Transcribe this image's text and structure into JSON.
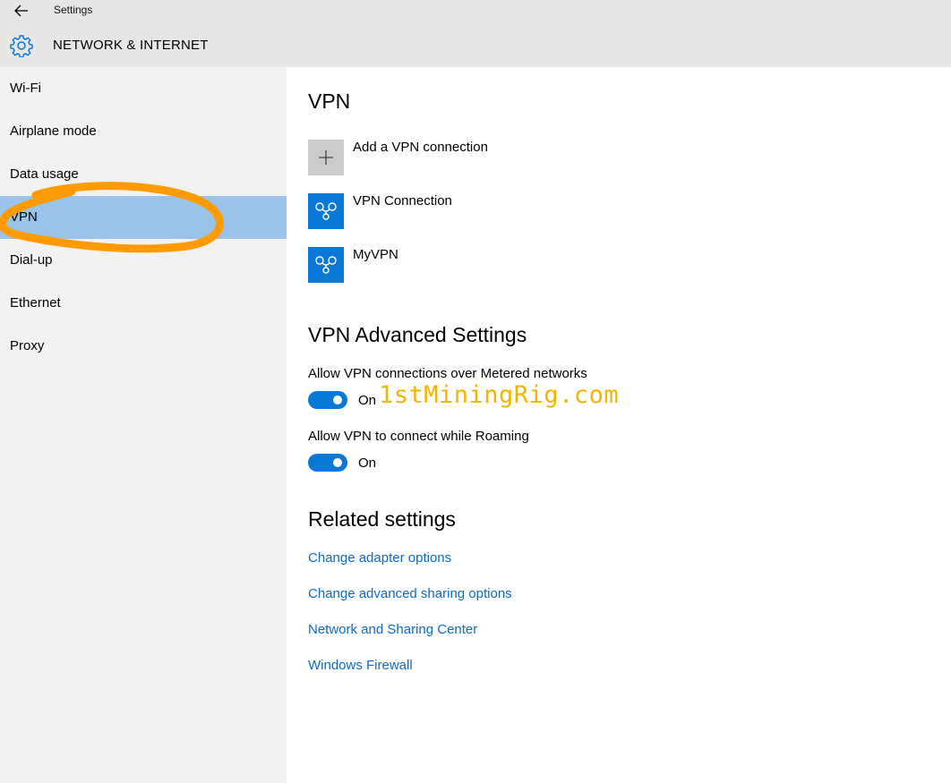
{
  "titlebar": {
    "app_title": "Settings"
  },
  "header": {
    "section_title": "NETWORK & INTERNET"
  },
  "sidebar": {
    "items": [
      {
        "label": "Wi-Fi",
        "selected": false
      },
      {
        "label": "Airplane mode",
        "selected": false
      },
      {
        "label": "Data usage",
        "selected": false
      },
      {
        "label": "VPN",
        "selected": true
      },
      {
        "label": "Dial-up",
        "selected": false
      },
      {
        "label": "Ethernet",
        "selected": false
      },
      {
        "label": "Proxy",
        "selected": false
      }
    ]
  },
  "vpn": {
    "heading": "VPN",
    "add_label": "Add a VPN connection",
    "connections": [
      {
        "label": "VPN Connection",
        "icon": "vpn-icon"
      },
      {
        "label": "MyVPN",
        "icon": "vpn-icon"
      }
    ]
  },
  "advanced": {
    "heading": "VPN Advanced Settings",
    "options": [
      {
        "label": "Allow VPN connections over Metered networks",
        "state": "On"
      },
      {
        "label": "Allow VPN to connect while Roaming",
        "state": "On"
      }
    ]
  },
  "watermark": "1stMiningRig.com",
  "related": {
    "heading": "Related settings",
    "links": [
      "Change adapter options",
      "Change advanced sharing options",
      "Network and Sharing Center",
      "Windows Firewall"
    ]
  },
  "colors": {
    "accent": "#0a78d7",
    "link": "#0a6cc4",
    "selected_nav": "#99c3e8",
    "annotation": "#ff9a00",
    "watermark": "#f5b400"
  }
}
